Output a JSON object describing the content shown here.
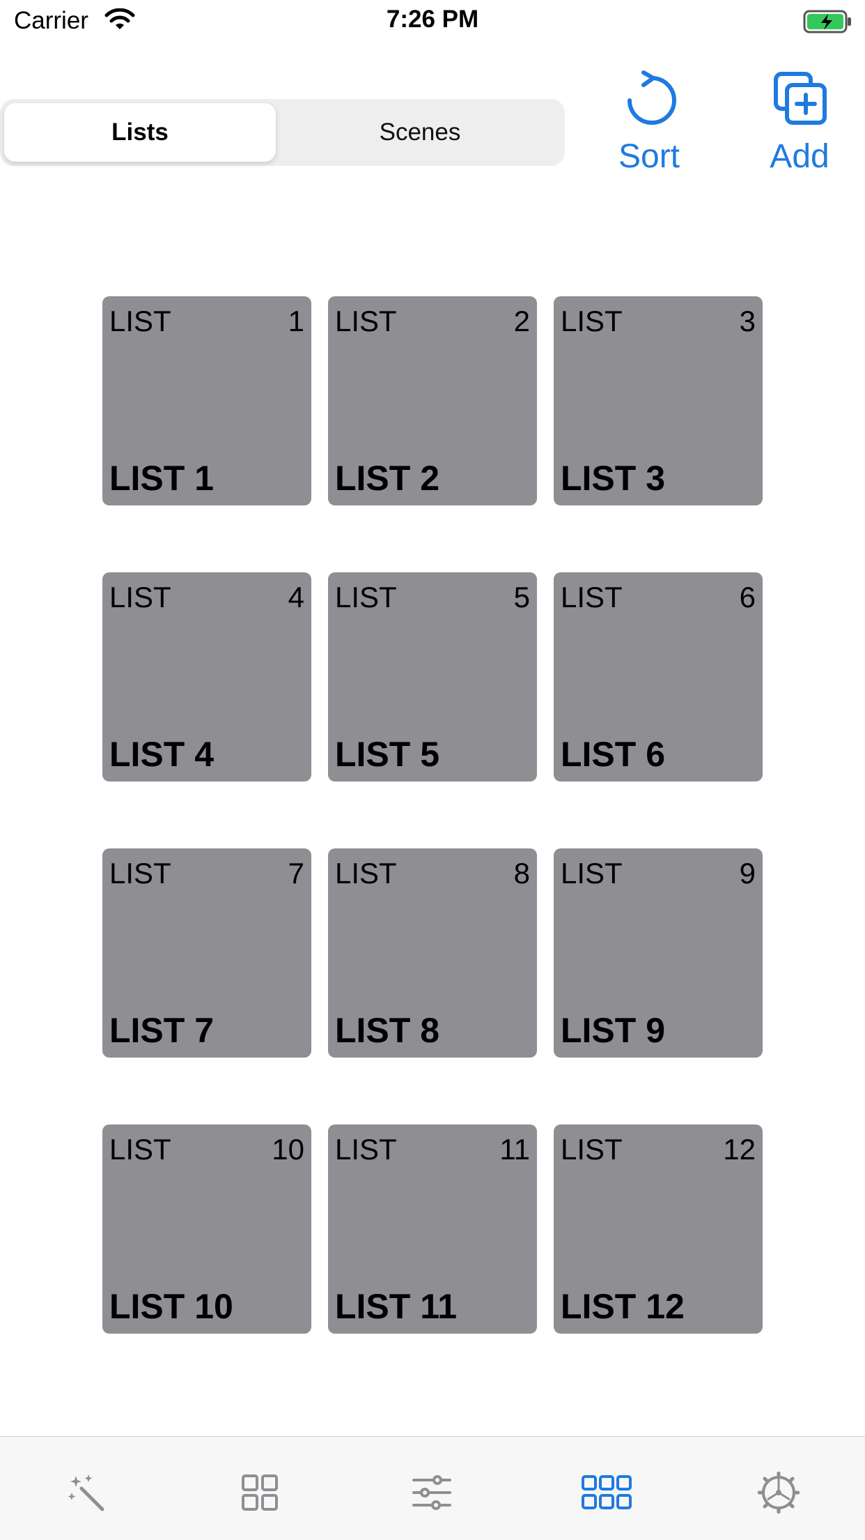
{
  "status_bar": {
    "carrier": "Carrier",
    "time": "7:26 PM",
    "battery_color": "#34c759"
  },
  "segmented_control": {
    "options": [
      "Lists",
      "Scenes"
    ],
    "selected": "Lists"
  },
  "toolbar": {
    "sort_label": "Sort",
    "add_label": "Add",
    "accent_color": "#1f7ae0"
  },
  "grid": {
    "tiles": [
      {
        "corner_label": "LIST",
        "number": "1",
        "name": "LIST 1"
      },
      {
        "corner_label": "LIST",
        "number": "2",
        "name": "LIST 2"
      },
      {
        "corner_label": "LIST",
        "number": "3",
        "name": "LIST 3"
      },
      {
        "corner_label": "LIST",
        "number": "4",
        "name": "LIST 4"
      },
      {
        "corner_label": "LIST",
        "number": "5",
        "name": "LIST 5"
      },
      {
        "corner_label": "LIST",
        "number": "6",
        "name": "LIST 6"
      },
      {
        "corner_label": "LIST",
        "number": "7",
        "name": "LIST 7"
      },
      {
        "corner_label": "LIST",
        "number": "8",
        "name": "LIST 8"
      },
      {
        "corner_label": "LIST",
        "number": "9",
        "name": "LIST 9"
      },
      {
        "corner_label": "LIST",
        "number": "10",
        "name": "LIST 10"
      },
      {
        "corner_label": "LIST",
        "number": "11",
        "name": "LIST 11"
      },
      {
        "corner_label": "LIST",
        "number": "12",
        "name": "LIST 12"
      }
    ],
    "tile_color": "#8e8e93"
  },
  "tab_bar": {
    "items": [
      {
        "icon": "magic-wand-icon"
      },
      {
        "icon": "grid-2x2-icon"
      },
      {
        "icon": "sliders-icon"
      },
      {
        "icon": "grid-3x2-icon",
        "selected": true
      },
      {
        "icon": "gear-icon"
      }
    ],
    "selected_color": "#1f7ae0",
    "inactive_color": "#8e8e93"
  }
}
